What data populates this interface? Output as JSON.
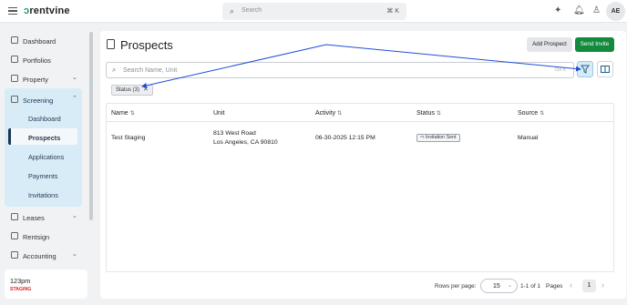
{
  "app": {
    "logo_text": "rentvine",
    "logo_mark": "ↄ"
  },
  "topbar": {
    "search_placeholder": "Search",
    "search_shortcut": "⌘ K",
    "avatar_initials": "AE"
  },
  "sidebar": {
    "items": [
      {
        "label": "Dashboard"
      },
      {
        "label": "Portfolios"
      },
      {
        "label": "Property"
      },
      {
        "label": "Screening"
      },
      {
        "label": "Leases"
      },
      {
        "label": "Rentsign"
      },
      {
        "label": "Accounting"
      }
    ],
    "screening_sub": [
      "Dashboard",
      "Prospects",
      "Applications",
      "Payments",
      "Invitations"
    ],
    "active_sub": "Prospects",
    "org": {
      "name": "123pm",
      "env": "STAGING"
    }
  },
  "page": {
    "title": "Prospects",
    "add_button": "Add Prospect",
    "send_button": "Send Invite",
    "search_placeholder": "Search Name, Unit",
    "search_shortcut": "Ctrl K",
    "filter_chip": "Status (3)"
  },
  "table": {
    "headers": [
      "Name",
      "Unit",
      "Activity",
      "Status",
      "Source"
    ],
    "rows": [
      {
        "name": "Test Staging",
        "unit_line1": "813 West Road",
        "unit_line2": "Los Angeles, CA 90810",
        "activity": "06-30-2025 12:15 PM",
        "status": "Invitation Sent",
        "source": "Manual"
      }
    ]
  },
  "pagination": {
    "rows_label": "Rows per page:",
    "rows_value": "15",
    "range": "1-1 of 1",
    "pages_label": "Pages",
    "current_page": "1"
  },
  "colors": {
    "brand_green": "#138a3e",
    "accent_blue": "#1d3557",
    "screening_bg": "#d7ecf7",
    "annotation_arrow": "#1f4fd6"
  }
}
